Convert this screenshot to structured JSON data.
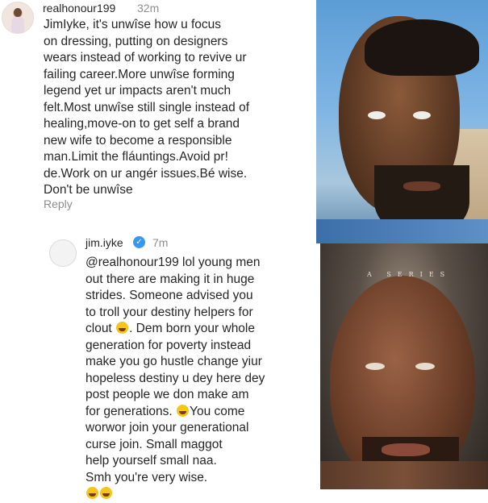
{
  "comment1": {
    "username": "realhonour199",
    "time": "32m",
    "text": "JimIyke, it's unwîse how u focus\non dressing, putting on designers\nwears instead of working to revive ur\nfailing career.More unwîse forming\nlegend yet ur impacts aren't much\nfelt.Most unwîse still single instead of\nhealing,move-on to get self a brand\nnew wife to become a responsible\nman.Limit the fláuntings.Avoid pr!\nde.Work on ur angér issues.Bé wise.\nDon't be unwîse",
    "reply_label": "Reply"
  },
  "comment2": {
    "username": "jim.iyke",
    "time": "7m",
    "verified": true,
    "line_1": "@realhonour199 lol young men\nout there are making it in huge\nstrides. Someone advised you\nto troll your destiny helpers for\nclout",
    "line_2": ". Dem born your whole\ngeneration for poverty instead\nmake you go hustle change yiur\nhopeless destiny u dey here dey\npost people we don make am\nfor generations.",
    "line_3": "You come\nworwor join your generational\ncurse join. Small maggot\nhelp yourself small naa.\nSmh you're very wise.",
    "emoji_name": "laughing-tears-emoji"
  },
  "photo_bottom": {
    "overlay_text": "A SERIES"
  }
}
